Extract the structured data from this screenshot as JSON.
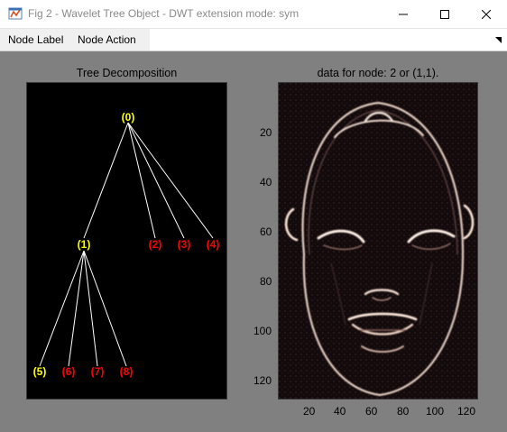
{
  "window": {
    "title": "Fig 2 - Wavelet Tree Object - DWT extension mode: sym"
  },
  "menu": {
    "items": [
      "Node Label",
      "Node Action"
    ]
  },
  "tree_panel": {
    "title": "Tree Decomposition",
    "nodes": [
      {
        "label": "(0)",
        "color": "#ffff00"
      },
      {
        "label": "(1)",
        "color": "#ffff00"
      },
      {
        "label": "(2)",
        "color": "#ff0000"
      },
      {
        "label": "(3)",
        "color": "#ff0000"
      },
      {
        "label": "(4)",
        "color": "#ff0000"
      },
      {
        "label": "(5)",
        "color": "#ffff00"
      },
      {
        "label": "(6)",
        "color": "#ff0000"
      },
      {
        "label": "(7)",
        "color": "#ff0000"
      },
      {
        "label": "(8)",
        "color": "#ff0000"
      }
    ]
  },
  "image_panel": {
    "title": "data for node: 2 or (1,1).",
    "y_ticks": [
      "20",
      "40",
      "60",
      "80",
      "100",
      "120"
    ],
    "x_ticks": [
      "20",
      "40",
      "60",
      "80",
      "100",
      "120"
    ],
    "colormap": "pink"
  }
}
